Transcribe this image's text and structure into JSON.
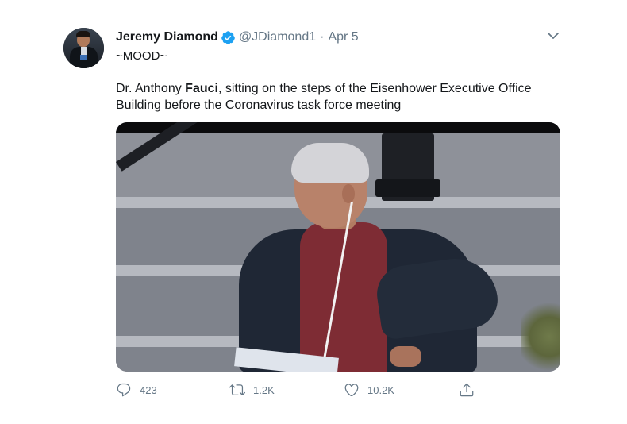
{
  "tweet": {
    "author_name": "Jeremy Diamond",
    "handle": "@JDiamond1",
    "separator": "·",
    "date": "Apr 5",
    "mood": "~MOOD~",
    "text_before": "Dr. Anthony ",
    "text_bold": "Fauci",
    "text_after": ", sitting on the steps of the Eisenhower Executive Office Building before the Coronavirus task force meeting"
  },
  "actions": {
    "reply_count": "423",
    "retweet_count": "1.2K",
    "like_count": "10.2K"
  },
  "icons": {
    "verified": "verified-badge-icon",
    "more": "chevron-down-icon",
    "reply": "reply-icon",
    "retweet": "retweet-icon",
    "like": "heart-icon",
    "share": "share-icon"
  },
  "colors": {
    "accent": "#1da1f2",
    "secondary_text": "#657786",
    "primary_text": "#14171a"
  }
}
